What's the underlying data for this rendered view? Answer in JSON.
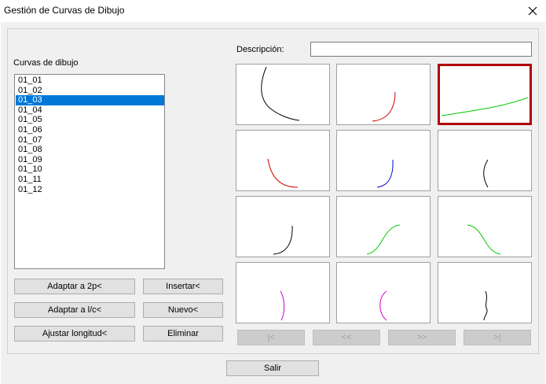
{
  "window": {
    "title": "Gestión de Curvas de Dibujo"
  },
  "labels": {
    "curves": "Curvas de dibujo",
    "description": "Descripción:"
  },
  "description_value": "",
  "curves": [
    "01_01",
    "01_02",
    "01_03",
    "01_04",
    "01_05",
    "01_06",
    "01_07",
    "01_08",
    "01_09",
    "01_10",
    "01_11",
    "01_12"
  ],
  "selected_curve": "01_03",
  "buttons": {
    "adapt_2p": "Adaptar a 2p<",
    "insert": "Insertar<",
    "adapt_lc": "Adaptar a l/c<",
    "new": "Nuevo<",
    "adjust_length": "Ajustar longitud<",
    "delete": "Eliminar",
    "exit": "Salir"
  },
  "nav": {
    "first": "|<",
    "prev": "<<",
    "next": ">>",
    "last": ">|"
  },
  "thumbnail_colors": [
    "#000000",
    "#cc0000",
    "#00cc00",
    "#cc0000",
    "#0000cc",
    "#000000",
    "#000000",
    "#00cc00",
    "#00cc00",
    "#cc00cc",
    "#cc00cc",
    "#000000"
  ]
}
